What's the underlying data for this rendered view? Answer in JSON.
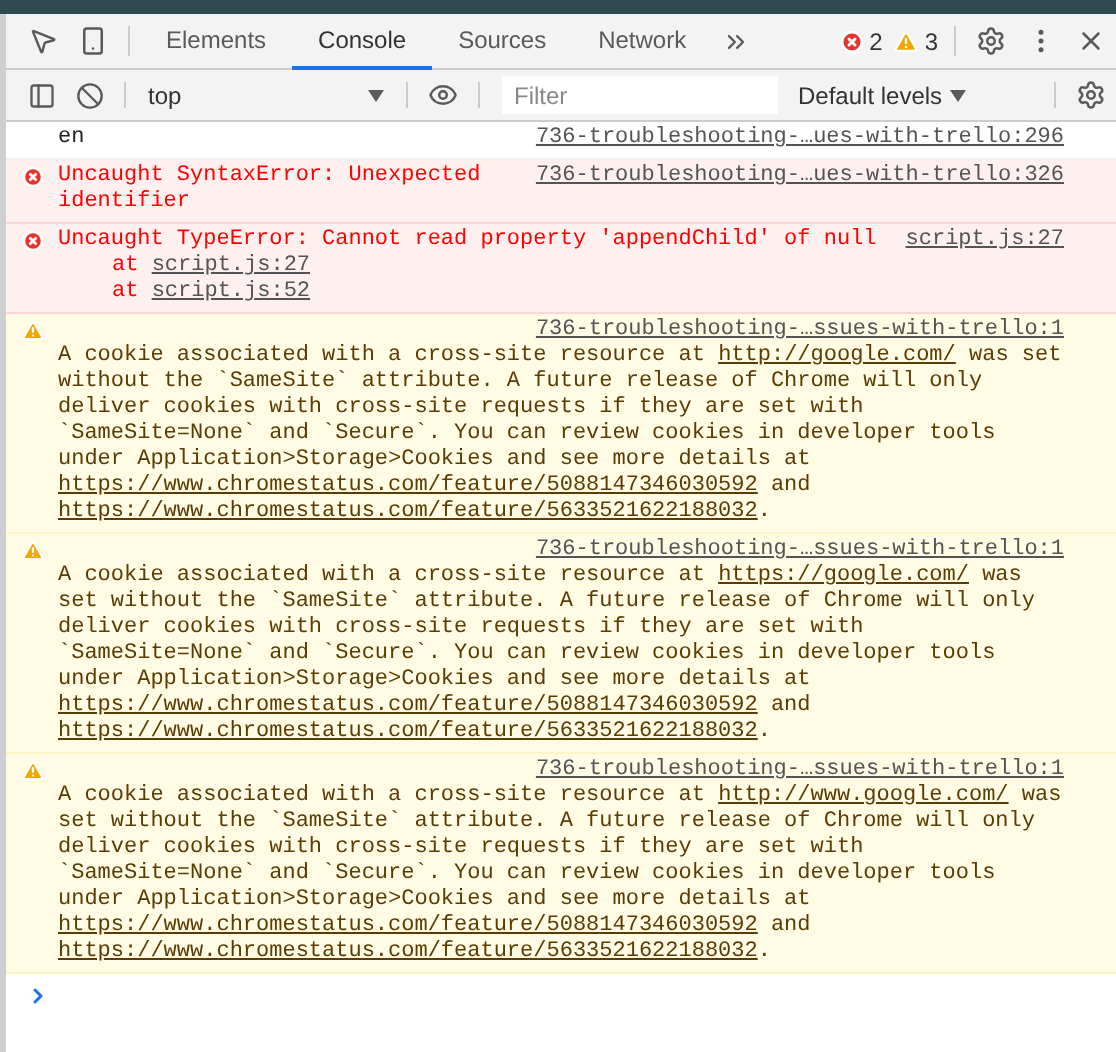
{
  "tabs": [
    {
      "label": "Elements",
      "selected": false
    },
    {
      "label": "Console",
      "selected": true
    },
    {
      "label": "Sources",
      "selected": false
    },
    {
      "label": "Network",
      "selected": false
    }
  ],
  "counts": {
    "errors": "2",
    "warnings": "3"
  },
  "console_toolbar": {
    "context": "top",
    "filter": {
      "placeholder": "Filter"
    },
    "levels": "Default levels"
  },
  "messages": [
    {
      "kind": "log",
      "source": "736-troubleshooting-…ues-with-trello:296",
      "parts": [
        {
          "kind": "text",
          "text": "en"
        }
      ]
    },
    {
      "kind": "error",
      "source": "736-troubleshooting-…ues-with-trello:326",
      "parts": [
        {
          "kind": "text",
          "text": "Uncaught SyntaxError: Unexpected identifier"
        }
      ]
    },
    {
      "kind": "error",
      "source": "script.js:27",
      "parts": [
        {
          "kind": "text",
          "text": "Uncaught TypeError: Cannot read property 'appendChild' of null"
        }
      ],
      "stack": [
        {
          "text": "at",
          "link": "script.js:27"
        },
        {
          "text": "at",
          "link": "script.js:52"
        }
      ]
    },
    {
      "kind": "warning",
      "source": "736-troubleshooting-…ssues-with-trello:1",
      "parts": [
        {
          "kind": "text",
          "text": "A cookie associated with a cross-site resource at "
        },
        {
          "kind": "link",
          "text": "http://google.com/"
        },
        {
          "kind": "text",
          "text": " was set without the `SameSite` attribute. A future release of Chrome will only deliver cookies with cross-site requests if they are set with `SameSite=None` and `Secure`. You can review cookies in developer tools under Application>Storage>Cookies and see more details at "
        },
        {
          "kind": "link",
          "text": "https://www.chromestatus.com/feature/5088147346030592"
        },
        {
          "kind": "text",
          "text": " and "
        },
        {
          "kind": "link",
          "text": "https://www.chromestatus.com/feature/5633521622188032"
        },
        {
          "kind": "text",
          "text": "."
        }
      ]
    },
    {
      "kind": "warning",
      "source": "736-troubleshooting-…ssues-with-trello:1",
      "parts": [
        {
          "kind": "text",
          "text": "A cookie associated with a cross-site resource at "
        },
        {
          "kind": "link",
          "text": "https://google.com/"
        },
        {
          "kind": "text",
          "text": " was set without the `SameSite` attribute. A future release of Chrome will only deliver cookies with cross-site requests if they are set with `SameSite=None` and `Secure`. You can review cookies in developer tools under Application>Storage>Cookies and see more details at "
        },
        {
          "kind": "link",
          "text": "https://www.chromestatus.com/feature/5088147346030592"
        },
        {
          "kind": "text",
          "text": " and "
        },
        {
          "kind": "link",
          "text": "https://www.chromestatus.com/feature/5633521622188032"
        },
        {
          "kind": "text",
          "text": "."
        }
      ]
    },
    {
      "kind": "warning",
      "source": "736-troubleshooting-…ssues-with-trello:1",
      "parts": [
        {
          "kind": "text",
          "text": "A cookie associated with a cross-site resource at "
        },
        {
          "kind": "link",
          "text": "http://www.google.com/"
        },
        {
          "kind": "text",
          "text": " was set without the `SameSite` attribute. A future release of Chrome will only deliver cookies with cross-site requests if they are set with `SameSite=None` and `Secure`. You can review cookies in developer tools under Application>Storage>Cookies and see more details at "
        },
        {
          "kind": "link",
          "text": "https://www.chromestatus.com/feature/5088147346030592"
        },
        {
          "kind": "text",
          "text": " and "
        },
        {
          "kind": "link",
          "text": "https://www.chromestatus.com/feature/5633521622188032"
        },
        {
          "kind": "text",
          "text": "."
        }
      ]
    }
  ]
}
